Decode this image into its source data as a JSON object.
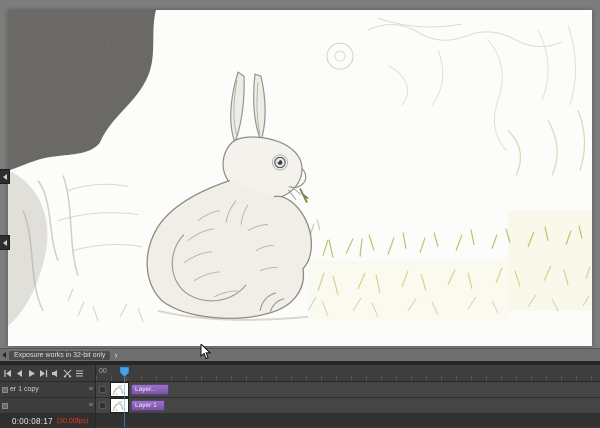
{
  "status_bar": {
    "hint": "Exposure works in 32-bit only"
  },
  "timeline": {
    "ruler_start_label": "00",
    "timecode": "0:00:08:17",
    "framerate": "(30.00fps)",
    "track_headers": [
      {
        "label": "er 1 copy"
      }
    ],
    "clips": [
      {
        "label": "Layer..."
      },
      {
        "label": "Layer 1"
      }
    ]
  },
  "colors": {
    "clip_purple": "#8a5fb0",
    "playhead_blue": "#4aa3e8",
    "framerate_red": "#e8372b"
  }
}
